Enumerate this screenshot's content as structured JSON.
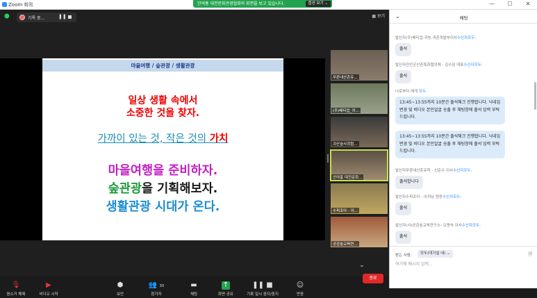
{
  "window": {
    "title": "Zoom 회의",
    "minimize": "—",
    "maximize": "☐",
    "close": "✕"
  },
  "banner": {
    "text": "안여홍 대전문화관광협회의 화면을 보고 있습니다.",
    "view_option": "옵션 보기 ⌄"
  },
  "topbar": {
    "recording_label": "기록 중...",
    "pause": "❚❚",
    "view": "▦ 보기"
  },
  "slide": {
    "header": "마을여행 / 숲관광 / 생활관광",
    "line1": "일상 생활 속에서",
    "line2": "소중한 것을 찾자.",
    "line3_a": "가까이 있는 것, 작은 것의 ",
    "line3_b": "가치",
    "line4": "마을여행을 준비하자.",
    "line5_a": "숲관광",
    "line5_b": "을 기획해보자.",
    "line6": "생활관광 시대가 온다."
  },
  "gallery": [
    {
      "name": "푸른내산촌유..."
    },
    {
      "name": "(주)배티업_귀..."
    },
    {
      "name": "괴산숲사회협..."
    },
    {
      "name": "안여홍 대전문화..."
    },
    {
      "name": "수피조아 - 이..."
    },
    {
      "name": "공감숲교육연..."
    }
  ],
  "gallery_more": "⌄",
  "toolbar": {
    "mute": "음소거 해제",
    "video": "비디오 시작",
    "security": "보안",
    "participants": "참가자",
    "participants_count": "30",
    "chat": "채팅",
    "share": "화면 공유",
    "record": "기록 일시 중지/중지",
    "reactions": "반응",
    "end": "종료"
  },
  "chat": {
    "title": "채팅",
    "messages": [
      {
        "from": "발신자(주)배티업-귀농.귀촌개발부이사",
        "to": "수신자모두:",
        "text": "출석"
      },
      {
        "from": "발신자진안군산촌특화협의체 - 김수임 대표",
        "to": "수신자모두:",
        "text": "출석"
      },
      {
        "from": "나로부터 에게",
        "to": "모두:",
        "text": "13:45~13:55까지 10분간 출석체크 진행합니다. 닉네임 변경 및 비디오 본인얼굴 송출 후 채팅창에 출석 입력 부탁드립니다."
      },
      {
        "from": "",
        "to": "",
        "text": "13:45~13:55까지 10분간 출석체크 진행합니다. 닉네임 변경 및 비디오 본인얼굴 송출 후 채팅창에 출석 입력 부탁드립니다."
      },
      {
        "from": "발신자푸른내산촌유학 - 신준수 이사",
        "to": "수신자모두:",
        "text": "출석합니다"
      },
      {
        "from": "발신자수피조아 - 이귀남 원장",
        "to": "수신자모두:",
        "text": "출석"
      },
      {
        "from": "발신자(사)공감숲교육연구소- 오명숙 이사",
        "to": "수신자모두:",
        "text": "출석"
      }
    ],
    "to_label": "받는 사람:",
    "to_value": "모두(대기실 내) ⌄",
    "placeholder": "여기에 메시지 입력...",
    "file_icon": "🗎"
  }
}
